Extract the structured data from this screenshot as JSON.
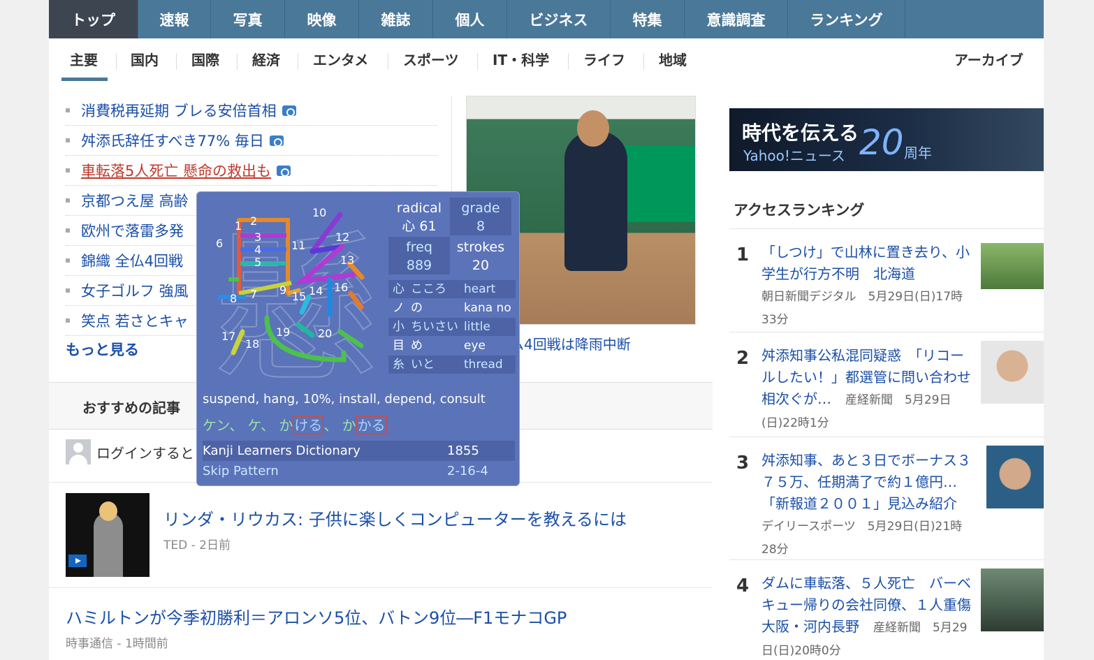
{
  "top_nav": [
    "トップ",
    "速報",
    "写真",
    "映像",
    "雑誌",
    "個人",
    "ビジネス",
    "特集",
    "意識調査",
    "ランキング"
  ],
  "sub_nav": [
    "主要",
    "国内",
    "国際",
    "経済",
    "エンタメ",
    "スポーツ",
    "IT・科学",
    "ライフ",
    "地域"
  ],
  "archive_label": "アーカイブ",
  "headlines": [
    {
      "text": "消費税再延期 ブレる安倍首相"
    },
    {
      "text": "舛添氏辞任すべき77% 毎日"
    },
    {
      "text": "車転落5人死亡 懸命の救出も"
    },
    {
      "text": "京都つえ屋 高齢"
    },
    {
      "text": "欧州で落雷多発"
    },
    {
      "text": "錦織 全仏4回戦"
    },
    {
      "text": "女子ゴルフ 強風"
    },
    {
      "text": "笑点 若さとキャ"
    }
  ],
  "more_label": "もっと見る",
  "photo_caption": "ム4回戦は降雨中断",
  "recommend_title": "おすすめの記事",
  "login_text": "ログインすると",
  "articles": [
    {
      "title": "リンダ・リウカス: 子供に楽しくコンピューターを教えるには",
      "meta": "TED - 2日前"
    },
    {
      "title": "ハミルトンが今季初勝利＝アロンソ5位、バトン9位―F1モナコGP",
      "meta": "時事通信 - 1時間前"
    }
  ],
  "banner": {
    "line1": "時代を伝える",
    "line2": "Yahoo!ニュース",
    "num": "20",
    "suffix": "周年"
  },
  "ranking_title": "アクセスランキング",
  "ranking": [
    {
      "num": "1",
      "title": "「しつけ」で山林に置き去り、小学生が行方不明　北海道",
      "source": "朝日新聞デジタル　5月29日(日)17時33分"
    },
    {
      "num": "2",
      "title": "舛添知事公私混同疑惑　「リコールしたい！」都選管に問い合わせ相次ぐが…",
      "source": "産経新聞　5月29日(日)22時1分"
    },
    {
      "num": "3",
      "title": "舛添知事、あと３日でボーナス３７５万、任期満了で約１億円…「新報道２００１」見込み紹介",
      "source": "デイリースポーツ　5月29日(日)21時28分"
    },
    {
      "num": "4",
      "title": "ダムに車転落、５人死亡　バーベキュー帰りの会社同僚、１人重傷　大阪・河内長野",
      "source": "産経新聞　5月29日(日)20時0分"
    }
  ],
  "kanji_popup": {
    "character": "懸",
    "stroke_numbers": [
      "1",
      "2",
      "3",
      "4",
      "5",
      "6",
      "7",
      "8",
      "9",
      "10",
      "11",
      "12",
      "13",
      "14",
      "15",
      "16",
      "17",
      "18",
      "19",
      "20"
    ],
    "radical_label": "radical",
    "radical_value": "心 61",
    "grade_label": "grade",
    "grade_value": "8",
    "freq_label": "freq",
    "freq_value": "889",
    "strokes_label": "strokes",
    "strokes_value": "20",
    "radicals": [
      {
        "k": "心",
        "r": "こころ",
        "e": "heart"
      },
      {
        "k": "ノ",
        "r": "の",
        "e": "kana no"
      },
      {
        "k": "小",
        "r": "ちいさい",
        "e": "little"
      },
      {
        "k": "目",
        "r": "め",
        "e": "eye"
      },
      {
        "k": "糸",
        "r": "いと",
        "e": "thread"
      }
    ],
    "meanings": "suspend, hang, 10%, install, depend, consult",
    "readings": {
      "a": "ケン、 ケ、 か",
      "b": "ける",
      "c": "、 か",
      "d": "かる"
    },
    "dict_name": "Kanji Learners Dictionary",
    "dict_value": "1855",
    "skip_name": "Skip Pattern",
    "skip_value": "2-16-4"
  }
}
